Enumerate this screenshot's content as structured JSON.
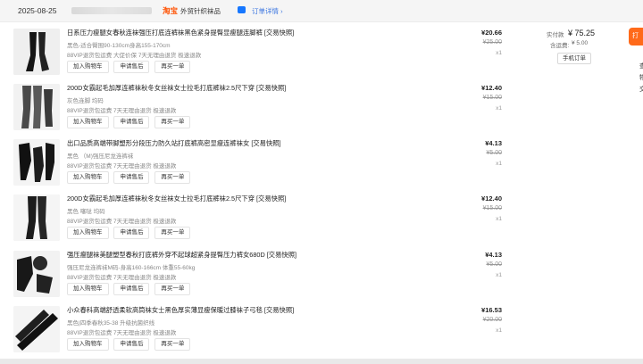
{
  "header": {
    "date": "2025-08-25",
    "platform": "淘宝",
    "shop_name": "外贸针织袜品",
    "detail_link": "订单详情",
    "detail_arrow": "›"
  },
  "side": {
    "orange_button": "打",
    "texts": [
      "查",
      "物",
      "交"
    ]
  },
  "payment": {
    "paid_label": "实付款",
    "paid_value": "¥ 75.25",
    "shipping_label": "含运费:",
    "shipping_value": "¥ 5.00",
    "modify_button": "手机订单"
  },
  "actions": {
    "add_cart": "加入购物车",
    "after_sale": "申请售后",
    "buy_again": "再买一单"
  },
  "items": [
    {
      "title": "日系压力瘦腿女春秋连袜强压打底连裤袜黑色紧身提臀显瘦腿连脚裤 [交易快照]",
      "spec": "黑色-适合臀围90-130cm身高155-170cm",
      "service": "88VIP退货包运费  大促价保  7天无理由退货  极速退款",
      "price": "¥20.66",
      "orig": "¥25.00",
      "qty": "x1"
    },
    {
      "title": "200D女霸起毛加厚连裤袜秋冬女丝袜女士拉毛打底裤袜2.5尺下穿 [交易快照]",
      "spec": "灰色连脚 均码",
      "service": "88VIP退货包运费  7天无理由退货  极速退款",
      "price": "¥12.40",
      "orig": "¥15.00",
      "qty": "x1"
    },
    {
      "title": "出口品质高端带脚塑形分段压力防久站打底裤高密显瘦连裤袜女 [交易快照]",
      "spec": "黑色  （M)强压尼龙连裤袜",
      "service": "88VIP退货包运费  7天无理由退货  极速退款",
      "price": "¥4.13",
      "orig": "¥5.00",
      "qty": "x1"
    },
    {
      "title": "200D女霸起毛加厚连裤袜秋冬女丝袜女士拉毛打底裤袜2.5尺下穿 [交易快照]",
      "spec": "黑色 噻哒 均码",
      "service": "88VIP退货包运费  7天无理由退货  极速退款",
      "price": "¥12.40",
      "orig": "¥15.00",
      "qty": "x1"
    },
    {
      "title": "强压瘦腿袜美腿塑型春秋打底裤外穿不起球超紧身提臀压力裤女680D [交易快照]",
      "spec": "强压尼龙连裤袜M码-身高160-166cm 体重55-60kg",
      "service": "88VIP退货包运费  7天无理由退货  极速退款",
      "price": "¥4.13",
      "orig": "¥5.00",
      "qty": "x1"
    },
    {
      "title": "小众春科高端舒透柔软高筒袜女士黑色厚实薄显瘦保暖过膝袜子弓毯 [交易快照]",
      "spec": "黑色|四季春秋35-38 升级抗菌织线",
      "service": "88VIP退货包运费  7天无理由退货  极速退款",
      "price": "¥16.53",
      "orig": "¥20.00",
      "qty": "x1"
    }
  ]
}
